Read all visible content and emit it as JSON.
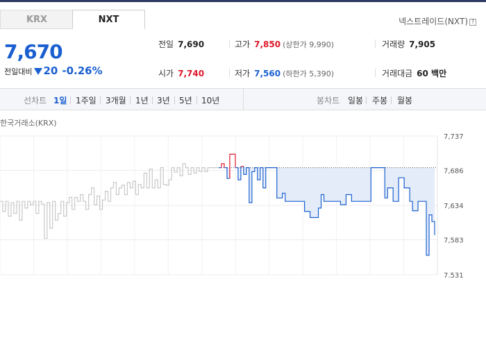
{
  "tabs": [
    {
      "label": "KRX",
      "active": false
    },
    {
      "label": "NXT",
      "active": true
    }
  ],
  "exchange_label": "넥스트레이드(NXT)",
  "help_glyph": "?",
  "price": {
    "current": "7,670",
    "change_label": "전일대비",
    "change_direction": "down",
    "change_value": "20",
    "change_percent": "-0.26%"
  },
  "stats": {
    "prev_close": {
      "label": "전일",
      "value": "7,690"
    },
    "high": {
      "label": "고가",
      "value": "7,850",
      "sub": "(상한가 9,990)"
    },
    "volume": {
      "label": "거래량",
      "value": "7,905"
    },
    "open": {
      "label": "시가",
      "value": "7,740"
    },
    "low": {
      "label": "저가",
      "value": "7,560",
      "sub": "(하한가 5,390)"
    },
    "trade_value": {
      "label": "거래대금",
      "value": "60 백만"
    }
  },
  "toolbar": {
    "line_chart_label": "선차트",
    "periods": [
      "1일",
      "1주일",
      "3개월",
      "1년",
      "3년",
      "5년",
      "10년"
    ],
    "active_period": "1일",
    "candle_chart_label": "봉차트",
    "candle_periods": [
      "일봉",
      "주봉",
      "월봉"
    ]
  },
  "chart_caption": "한국거래소(KRX)",
  "colors": {
    "up": "#e0162b",
    "down": "#1a5fd0",
    "fill": "#e3ecf8",
    "krx_line": "#c8c8c8"
  },
  "chart_data": {
    "type": "line",
    "title": "",
    "xlabel": "",
    "ylabel": "",
    "ylim": [
      7531,
      7737
    ],
    "yticks": [
      "7,737",
      "7,686",
      "7,634",
      "7,583",
      "7,531"
    ],
    "ytick_values": [
      7737,
      7686,
      7634,
      7583,
      7531
    ],
    "reference_line": 7690,
    "x_range": [
      0,
      158
    ],
    "series": [
      {
        "x": [
          0,
          1,
          2,
          3,
          4,
          5,
          6,
          7,
          8,
          9,
          10,
          11,
          12,
          13,
          14,
          15,
          16,
          17,
          18,
          19,
          20,
          21,
          22,
          23,
          24,
          25,
          26,
          27,
          28,
          29,
          30,
          31,
          32,
          33,
          34,
          35,
          36,
          37,
          38,
          39,
          40,
          41,
          42,
          43,
          44,
          45,
          46,
          47,
          48,
          49,
          50,
          51,
          52,
          53,
          54,
          55,
          56,
          57,
          58,
          59,
          60,
          61,
          62,
          63,
          64,
          65,
          66,
          67,
          68,
          69,
          70,
          71,
          72,
          73,
          74,
          75,
          76,
          77,
          78,
          79
        ],
        "y": [
          7640,
          7625,
          7640,
          7618,
          7638,
          7622,
          7640,
          7612,
          7640,
          7630,
          7640,
          7635,
          7640,
          7622,
          7640,
          7636,
          7585,
          7638,
          7600,
          7640,
          7612,
          7622,
          7640,
          7618,
          7638,
          7646,
          7628,
          7646,
          7640,
          7650,
          7640,
          7628,
          7650,
          7660,
          7635,
          7648,
          7628,
          7642,
          7655,
          7640,
          7660,
          7668,
          7650,
          7660,
          7664,
          7650,
          7668,
          7660,
          7670,
          7650,
          7665,
          7660,
          7682,
          7660,
          7688,
          7660,
          7672,
          7660,
          7690,
          7665,
          7664,
          7672,
          7690,
          7683,
          7690,
          7678,
          7696,
          7690,
          7680,
          7690,
          7682,
          7690,
          7684,
          7690,
          7684,
          7690,
          7690,
          7690,
          7690,
          7690
        ]
      },
      {
        "x": [
          79,
          80,
          81,
          82,
          83,
          84,
          85,
          86,
          87,
          88,
          89,
          90,
          91,
          92,
          93,
          94,
          95,
          96,
          97,
          98,
          99,
          100,
          101,
          102,
          103,
          104,
          105,
          106,
          107,
          108,
          109,
          110,
          111,
          112,
          113,
          114,
          115,
          116,
          117,
          118,
          119,
          120,
          121,
          122,
          123,
          124,
          125,
          126,
          127,
          128,
          129,
          130,
          131,
          132,
          133,
          134,
          135,
          136,
          137,
          138,
          139,
          140,
          141,
          142,
          143,
          144,
          145,
          146,
          147,
          148,
          149,
          150,
          151,
          152,
          153,
          154,
          155,
          156,
          157
        ],
        "y": [
          7690,
          7696,
          7690,
          7674,
          7710,
          7710,
          7690,
          7672,
          7692,
          7680,
          7690,
          7638,
          7684,
          7690,
          7672,
          7690,
          7660,
          7690,
          7690,
          7690,
          7690,
          7645,
          7645,
          7652,
          7640,
          7640,
          7640,
          7640,
          7640,
          7640,
          7640,
          7625,
          7625,
          7616,
          7616,
          7616,
          7630,
          7650,
          7640,
          7640,
          7640,
          7640,
          7640,
          7640,
          7635,
          7635,
          7650,
          7650,
          7640,
          7640,
          7640,
          7640,
          7640,
          7640,
          7640,
          7690,
          7690,
          7690,
          7690,
          7690,
          7645,
          7660,
          7660,
          7640,
          7640,
          7675,
          7675,
          7660,
          7660,
          7640,
          7626,
          7626,
          7640,
          7640,
          7640,
          7560,
          7620,
          7610,
          7590
        ]
      }
    ]
  }
}
